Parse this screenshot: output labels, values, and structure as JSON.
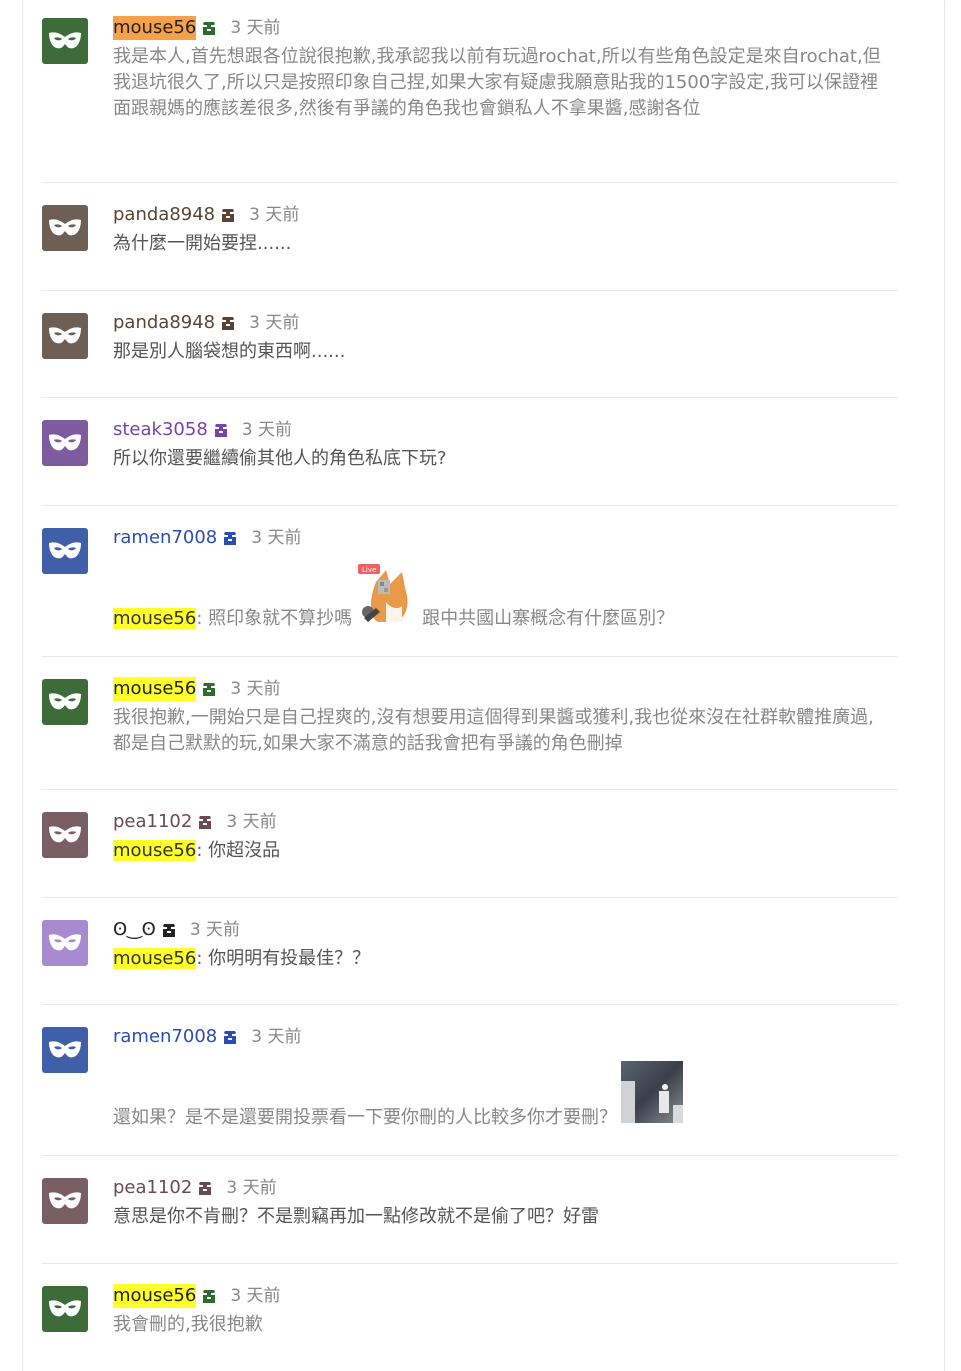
{
  "comments": [
    {
      "author": "mouse56",
      "time": "3 天前",
      "avatar_color": "#3d6b3a",
      "author_color": "#222222",
      "highlight": "orange",
      "text": "我是本人,首先想跟各位說很抱歉,我承認我以前有玩過rochat,所以有些角色設定是來自rochat,但我退坑很久了,所以只是按照印象自己捏,如果大家有疑慮我願意貼我的1500字設定,我可以保證裡面跟親媽的應該差很多,然後有爭議的角色我也會鎖私人不拿果醬,感謝各位"
    },
    {
      "author": "panda8948",
      "time": "3 天前",
      "avatar_color": "#6e5f55",
      "author_color": "#5a4436",
      "text": "為什麼一開始要捏......"
    },
    {
      "author": "panda8948",
      "time": "3 天前",
      "avatar_color": "#6e5f55",
      "author_color": "#5a4436",
      "text": "那是別人腦袋想的東西啊......"
    },
    {
      "author": "steak3058",
      "time": "3 天前",
      "avatar_color": "#7d5b9e",
      "author_color": "#7a43a8",
      "text": "所以你還要繼續偷其他人的角色私底下玩?"
    },
    {
      "author": "ramen7008",
      "time": "3 天前",
      "avatar_color": "#3f5fa8",
      "author_color": "#2a4db5",
      "mention": "mouse56",
      "text_before": "照印象就不算抄嗎",
      "text_after": "跟中共國山寨概念有什麼區別？",
      "sticker_label": "Live"
    },
    {
      "author": "mouse56",
      "time": "3 天前",
      "avatar_color": "#3d6b3a",
      "author_color": "#222222",
      "highlight": "yellow",
      "text": "我很抱歉,一開始只是自己捏爽的,沒有想要用這個得到果醬或獲利,我也從來沒在社群軟體推廣過,都是自己默默的玩,如果大家不滿意的話我會把有爭議的角色刪掉"
    },
    {
      "author": "pea1102",
      "time": "3 天前",
      "avatar_color": "#7a5e66",
      "author_color": "#6b4a55",
      "mention": "mouse56",
      "text": "你超沒品"
    },
    {
      "author": "ʘ‿ʘ",
      "time": "3 天前",
      "avatar_color": "#a88ad0",
      "author_color": "#222222",
      "mention": "mouse56",
      "text": "你明明有投最佳？？"
    },
    {
      "author": "ramen7008",
      "time": "3 天前",
      "avatar_color": "#3f5fa8",
      "author_color": "#2a4db5",
      "text": "還如果？是不是還要開投票看一下要你刪的人比較多你才要刪？"
    },
    {
      "author": "pea1102",
      "time": "3 天前",
      "avatar_color": "#7a5e66",
      "author_color": "#6b4a55",
      "text": "意思是你不肯刪？不是剽竊再加一點修改就不是偷了吧？好雷"
    },
    {
      "author": "mouse56",
      "time": "3 天前",
      "avatar_color": "#3d6b3a",
      "author_color": "#222222",
      "highlight": "yellow",
      "text": "我會刪的,我很抱歉"
    }
  ]
}
